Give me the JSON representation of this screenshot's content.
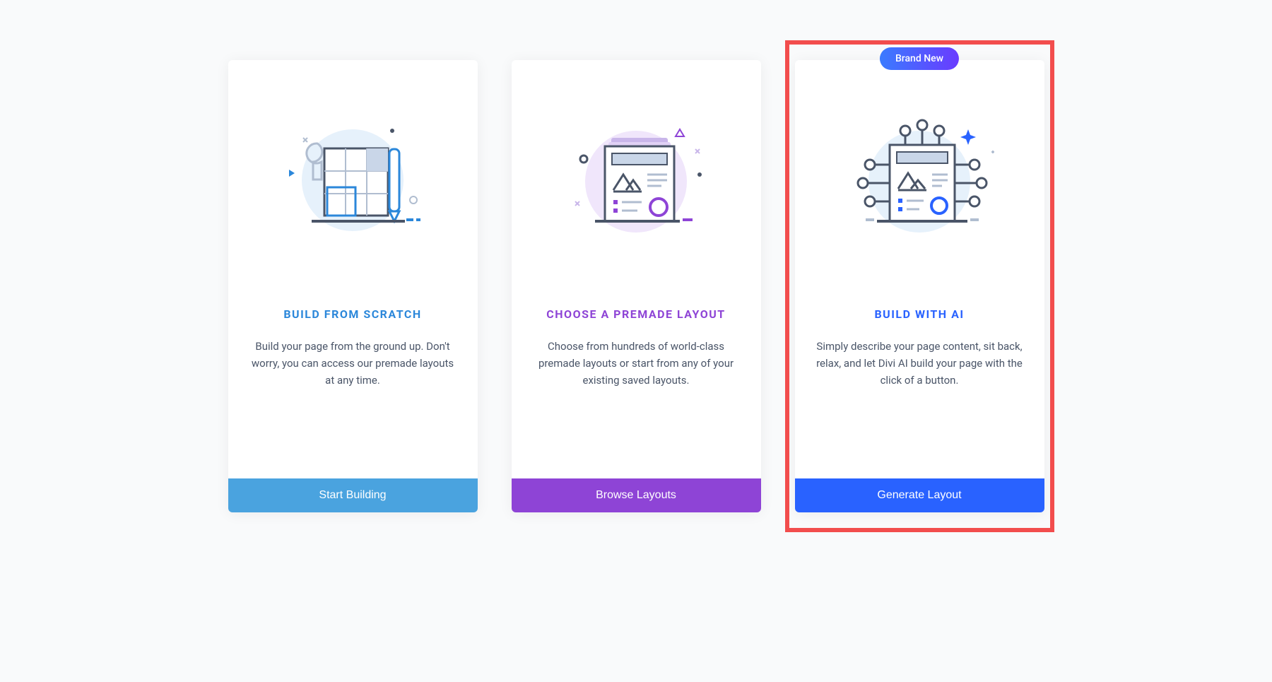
{
  "cards": [
    {
      "title": "BUILD FROM SCRATCH",
      "desc": "Build your page from the ground up. Don't worry, you can access our premade layouts at any time.",
      "button": "Start Building"
    },
    {
      "title": "CHOOSE A PREMADE LAYOUT",
      "desc": "Choose from hundreds of world-class premade layouts or start from any of your existing saved layouts.",
      "button": "Browse Layouts"
    },
    {
      "badge": "Brand New",
      "title": "BUILD WITH AI",
      "desc": "Simply describe your page content, sit back, relax, and let Divi AI build your page with the click of a button.",
      "button": "Generate Layout"
    }
  ],
  "colors": {
    "blue": "#2b87da",
    "purple": "#8e44d6",
    "dblue": "#2962ff",
    "highlight": "#f24d4d"
  }
}
